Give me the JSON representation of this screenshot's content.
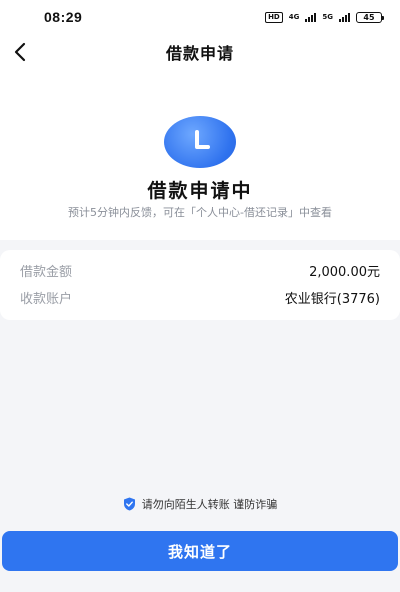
{
  "status_bar": {
    "time": "08:29",
    "hd_badge": "HD",
    "network_a": "4G",
    "network_b": "5G",
    "battery": "45"
  },
  "nav": {
    "title": "借款申请"
  },
  "hero": {
    "title": "借款申请中",
    "subtitle": "预计5分钟内反馈，可在「个人中心-借还记录」中查看"
  },
  "info": {
    "rows": [
      {
        "label": "借款金额",
        "value": "2,000.00元"
      },
      {
        "label": "收款账户",
        "value": "农业银行(3776)"
      }
    ]
  },
  "tip": {
    "text": "请勿向陌生人转账 谨防诈骗"
  },
  "confirm": {
    "label": "我知道了"
  },
  "colors": {
    "accent": "#2f75f0",
    "background": "#f4f5f8",
    "muted_text": "#8a8f99"
  }
}
